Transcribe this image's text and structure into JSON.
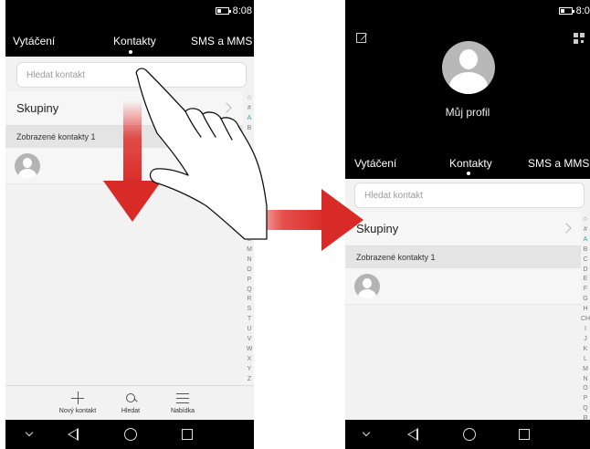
{
  "status": {
    "time": "8:08"
  },
  "tabs": {
    "dialer": "Vytáčení",
    "contacts": "Kontakty",
    "messages": "SMS a MMS"
  },
  "search": {
    "placeholder": "Hledat kontakt"
  },
  "groups": {
    "label": "Skupiny"
  },
  "section": {
    "displayed_contacts": "Zobrazené kontakty  1"
  },
  "profile": {
    "name": "Můj profil"
  },
  "index_letters_top": [
    "☆",
    "#",
    "A",
    "B"
  ],
  "index_letters_phone1_lower": [
    "L",
    "M",
    "N",
    "O",
    "P",
    "Q",
    "R",
    "S",
    "T",
    "U",
    "V",
    "W",
    "X",
    "Y",
    "Z"
  ],
  "index_letters_phone2": [
    "☆",
    "#",
    "A",
    "B",
    "C",
    "D",
    "E",
    "F",
    "G",
    "H",
    "CH",
    "I",
    "J",
    "K",
    "L",
    "M",
    "N",
    "O",
    "P",
    "Q",
    "R"
  ],
  "toolbar": {
    "new_contact": "Nový kontakt",
    "search": "Hledat",
    "menu": "Nabídka"
  },
  "icons": [
    "battery-icon",
    "plus-icon",
    "magnify-icon",
    "menu-icon",
    "nav-down-icon",
    "nav-back-icon",
    "nav-home-icon",
    "nav-recent-icon",
    "edit-icon",
    "qr-code-icon",
    "chevron-right-icon",
    "avatar-icon",
    "hand-gesture-icon",
    "arrow-down-icon",
    "arrow-right-icon"
  ],
  "colors": {
    "accent": "#2aa89a",
    "arrow_red": "#e0302d",
    "header_bg": "#000000",
    "list_bg": "#f2f2f2"
  }
}
